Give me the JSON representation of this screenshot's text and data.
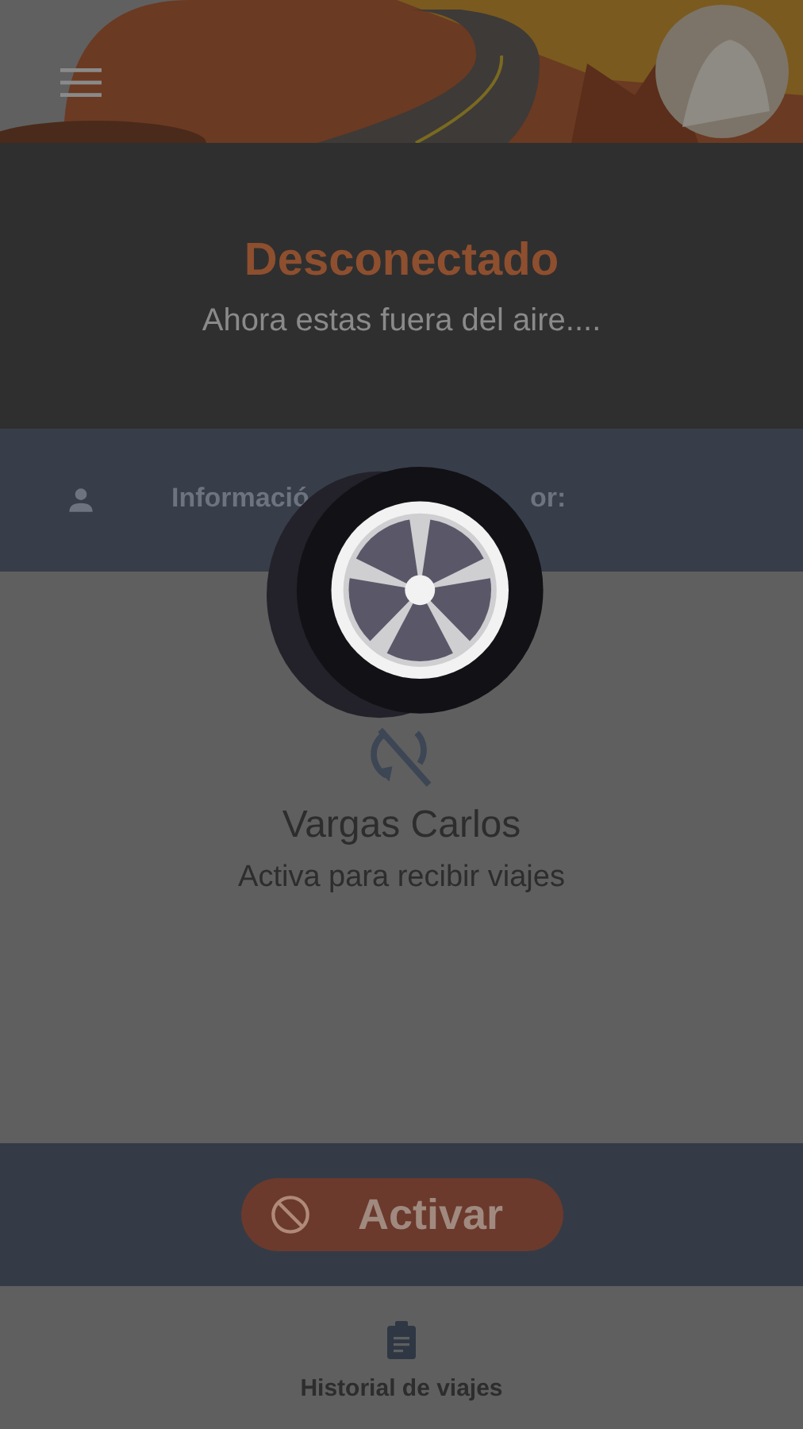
{
  "status": {
    "title": "Desconectado",
    "subtitle": "Ahora estas fuera del aire...."
  },
  "info_bar": {
    "label_parts": [
      "Informació",
      "or:"
    ]
  },
  "driver": {
    "name": "Vargas Carlos",
    "prompt": "Activa para recibir viajes"
  },
  "action": {
    "label": "Activar"
  },
  "bottom_nav": [
    {
      "label": "Historial de viajes"
    }
  ],
  "loading": true
}
